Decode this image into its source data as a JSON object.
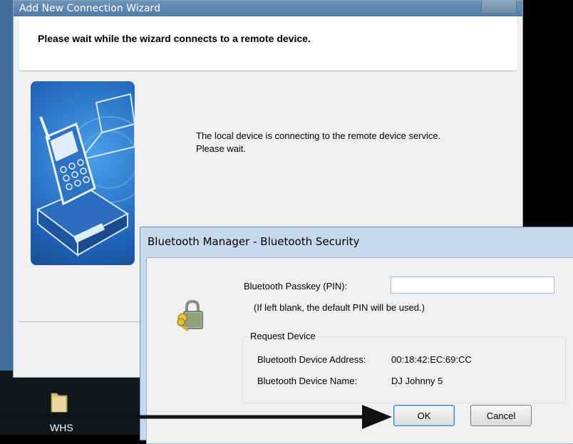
{
  "wizard": {
    "title": "Add New Connection Wizard",
    "header": "Please wait while the wizard connects to a remote device.",
    "message_line1": "The local device is connecting to the remote device service.",
    "message_line2": "Please wait.",
    "close_icon": "close-icon"
  },
  "dialog": {
    "title": "Bluetooth Manager - Bluetooth Security",
    "icon": "lock-with-keys-icon",
    "pin_label": "Bluetooth Passkey (PIN):",
    "pin_value": "",
    "pin_hint": "(If left blank, the default PIN will be used.)",
    "group_title": "Request Device",
    "address_label": "Bluetooth Device Address:",
    "address_value": "00:18:42:EC:69:CC",
    "name_label": "Bluetooth Device Name:",
    "name_value": "DJ Johnny 5",
    "ok_label": "OK",
    "cancel_label": "Cancel"
  },
  "desktop": {
    "icon_label": "WHS",
    "icon": "folder-icon",
    "pointer": "arrow-pointer"
  }
}
